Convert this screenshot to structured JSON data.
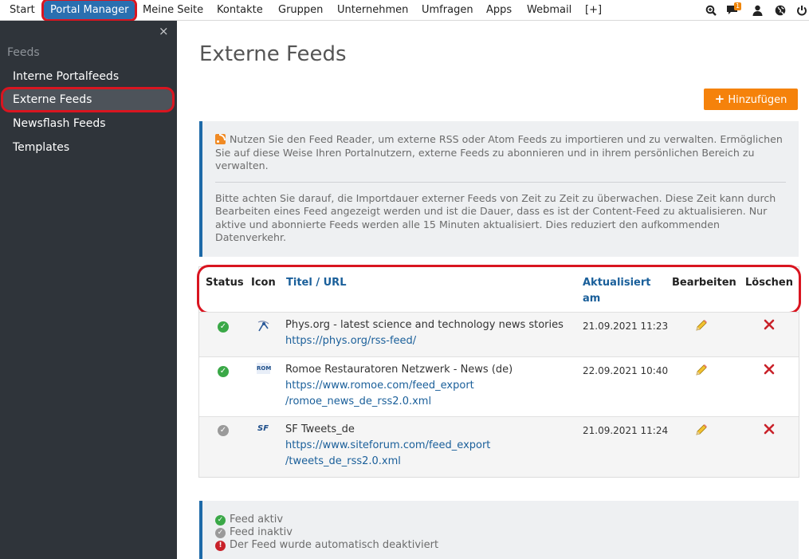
{
  "nav": {
    "items": [
      "Start",
      "Portal Manager",
      "Meine Seite",
      "Kontakte",
      "Gruppen",
      "Unternehmen",
      "Umfragen",
      "Apps",
      "Webmail",
      "[+]"
    ],
    "badge_count": "1"
  },
  "sidebar": {
    "close": "×",
    "section_title": "Feeds",
    "items": [
      "Interne Portalfeeds",
      "Externe Feeds",
      "Newsflash Feeds",
      "Templates"
    ]
  },
  "page": {
    "title": "Externe Feeds",
    "add_button": "Hinzufügen"
  },
  "info": {
    "para1": "Nutzen Sie den Feed Reader, um externe RSS oder Atom Feeds zu importieren und zu verwalten. Ermöglichen Sie auf diese Weise Ihren Portalnutzern, externe Feeds zu abonnieren und in ihrem persönlichen Bereich zu verwalten.",
    "para2": "Bitte achten Sie darauf, die Importdauer externer Feeds von Zeit zu Zeit zu überwachen. Diese Zeit kann durch Bearbeiten eines Feed angezeigt werden und ist die Dauer, dass es ist der Content-Feed zu aktualisieren. Nur aktive und abonnierte Feeds werden alle 15 Minuten aktualisiert. Dies reduziert den aufkommenden Datenverkehr."
  },
  "table": {
    "headers": {
      "status": "Status",
      "icon": "Icon",
      "title_a": "Titel",
      "title_sep": " / ",
      "title_b": "URL",
      "updated_1": "Aktualisiert",
      "updated_2": "am",
      "edit": "Bearbeiten",
      "delete": "Löschen"
    },
    "rows": [
      {
        "status": "active",
        "icon_text": "",
        "title": "Phys.org - latest science and technology news stories",
        "url1": "https://phys.org/rss-feed/",
        "url2": "",
        "date": "21.09.2021 11:23"
      },
      {
        "status": "active",
        "icon_text": "ROM",
        "title": "Romoe Restauratoren Netzwerk - News (de)",
        "url1": "https://www.romoe.com/feed_export",
        "url2": "/romoe_news_de_rss2.0.xml",
        "date": "22.09.2021 10:40"
      },
      {
        "status": "inactive",
        "icon_text": "SF",
        "title": "SF Tweets_de",
        "url1": "https://www.siteforum.com/feed_export",
        "url2": "/tweets_de_rss2.0.xml",
        "date": "21.09.2021 11:24"
      }
    ]
  },
  "legend": {
    "active": "Feed aktiv",
    "inactive": "Feed inaktiv",
    "error": "Der Feed wurde automatisch deaktiviert"
  },
  "colors": {
    "accent": "#1e6aa8",
    "add_button": "#f5820b",
    "sidebar": "#2f343a",
    "status_active": "#3aa847",
    "status_inactive": "#9a9a9a",
    "status_error": "#c9222a",
    "highlight": "#d91520"
  }
}
